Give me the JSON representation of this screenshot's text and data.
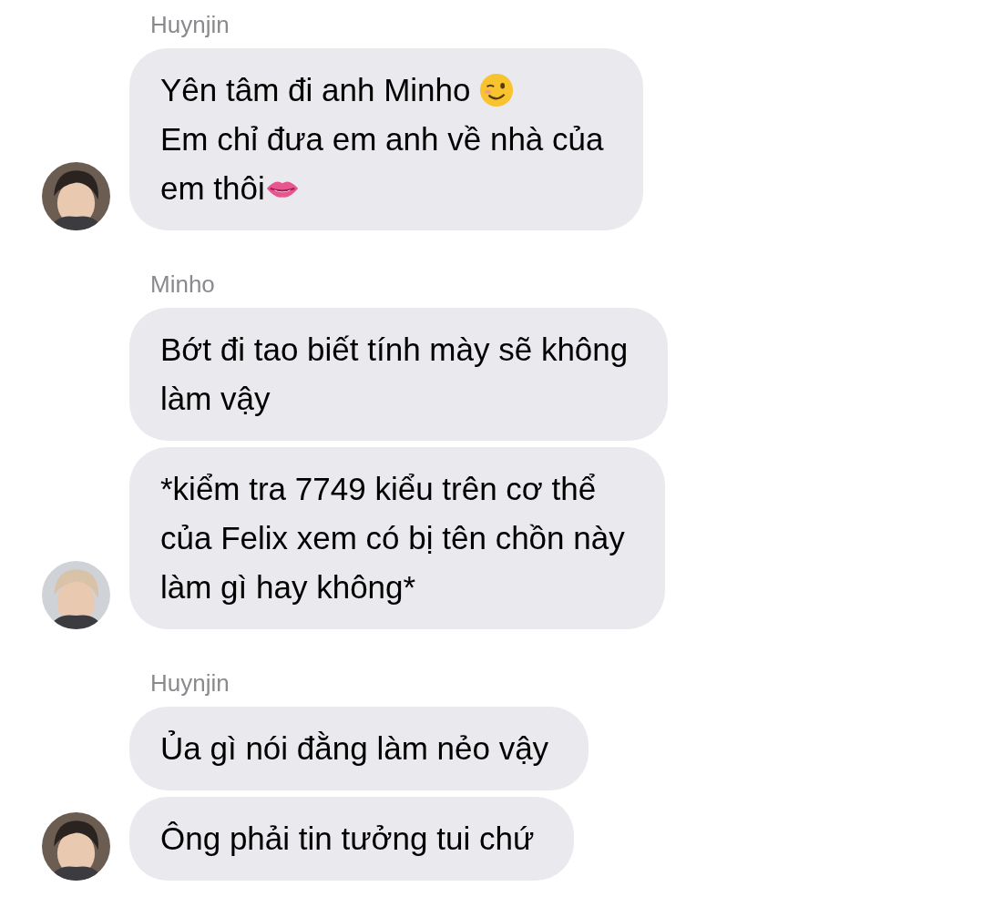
{
  "groups": [
    {
      "sender": "Huynjin",
      "messages": [
        {
          "lines": [
            [
              {
                "kind": "text",
                "text": "Yên tâm đi anh Minho"
              },
              {
                "kind": "wink"
              }
            ],
            [
              {
                "kind": "text",
                "text": "Em chỉ đưa em anh về nhà của"
              }
            ],
            [
              {
                "kind": "text",
                "text": "em thôi"
              },
              {
                "kind": "lips"
              }
            ]
          ]
        }
      ]
    },
    {
      "sender": "Minho",
      "messages": [
        {
          "lines": [
            [
              {
                "kind": "text",
                "text": "Bớt đi tao biết tính mày sẽ không"
              }
            ],
            [
              {
                "kind": "text",
                "text": "làm vậy"
              }
            ]
          ]
        },
        {
          "lines": [
            [
              {
                "kind": "text",
                "text": "*kiểm tra 7749 kiểu trên cơ thể"
              }
            ],
            [
              {
                "kind": "text",
                "text": "của Felix xem có bị tên chồn này"
              }
            ],
            [
              {
                "kind": "text",
                "text": "làm gì hay không*"
              }
            ]
          ]
        }
      ]
    },
    {
      "sender": "Huynjin",
      "messages": [
        {
          "lines": [
            [
              {
                "kind": "text",
                "text": "Ủa gì nói đằng làm nẻo vậy"
              }
            ]
          ]
        },
        {
          "lines": [
            [
              {
                "kind": "text",
                "text": "Ông phải tin tưởng tui chứ"
              }
            ]
          ]
        }
      ]
    }
  ]
}
